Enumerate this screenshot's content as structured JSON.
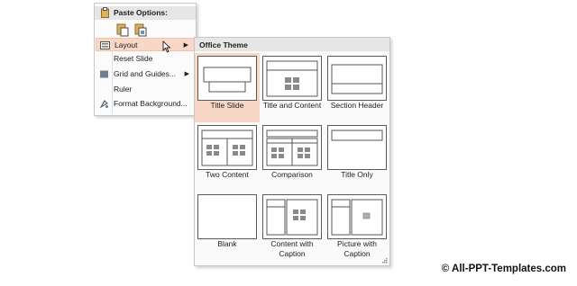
{
  "context_menu": {
    "paste_header": "Paste Options:",
    "items": [
      {
        "label": "Layout",
        "icon": "layout-icon",
        "submenu": true
      },
      {
        "label": "Reset Slide",
        "icon": "",
        "submenu": false
      },
      {
        "label": "Grid and Guides...",
        "icon": "grid-icon",
        "submenu": true
      },
      {
        "label": "Ruler",
        "icon": "",
        "submenu": false
      },
      {
        "label": "Format Background...",
        "icon": "format-background-icon",
        "submenu": false
      }
    ]
  },
  "layout_gallery": {
    "title": "Office Theme",
    "selected": "Title Slide",
    "layouts": [
      "Title Slide",
      "Title and Content",
      "Section Header",
      "Two Content",
      "Comparison",
      "Title Only",
      "Blank",
      "Content with\nCaption",
      "Picture with\nCaption"
    ]
  },
  "watermark": "© All-PPT-Templates.com",
  "colors": {
    "highlight": "#f8d7c6",
    "border": "#c8c8c8",
    "header": "#e6e6e6"
  }
}
